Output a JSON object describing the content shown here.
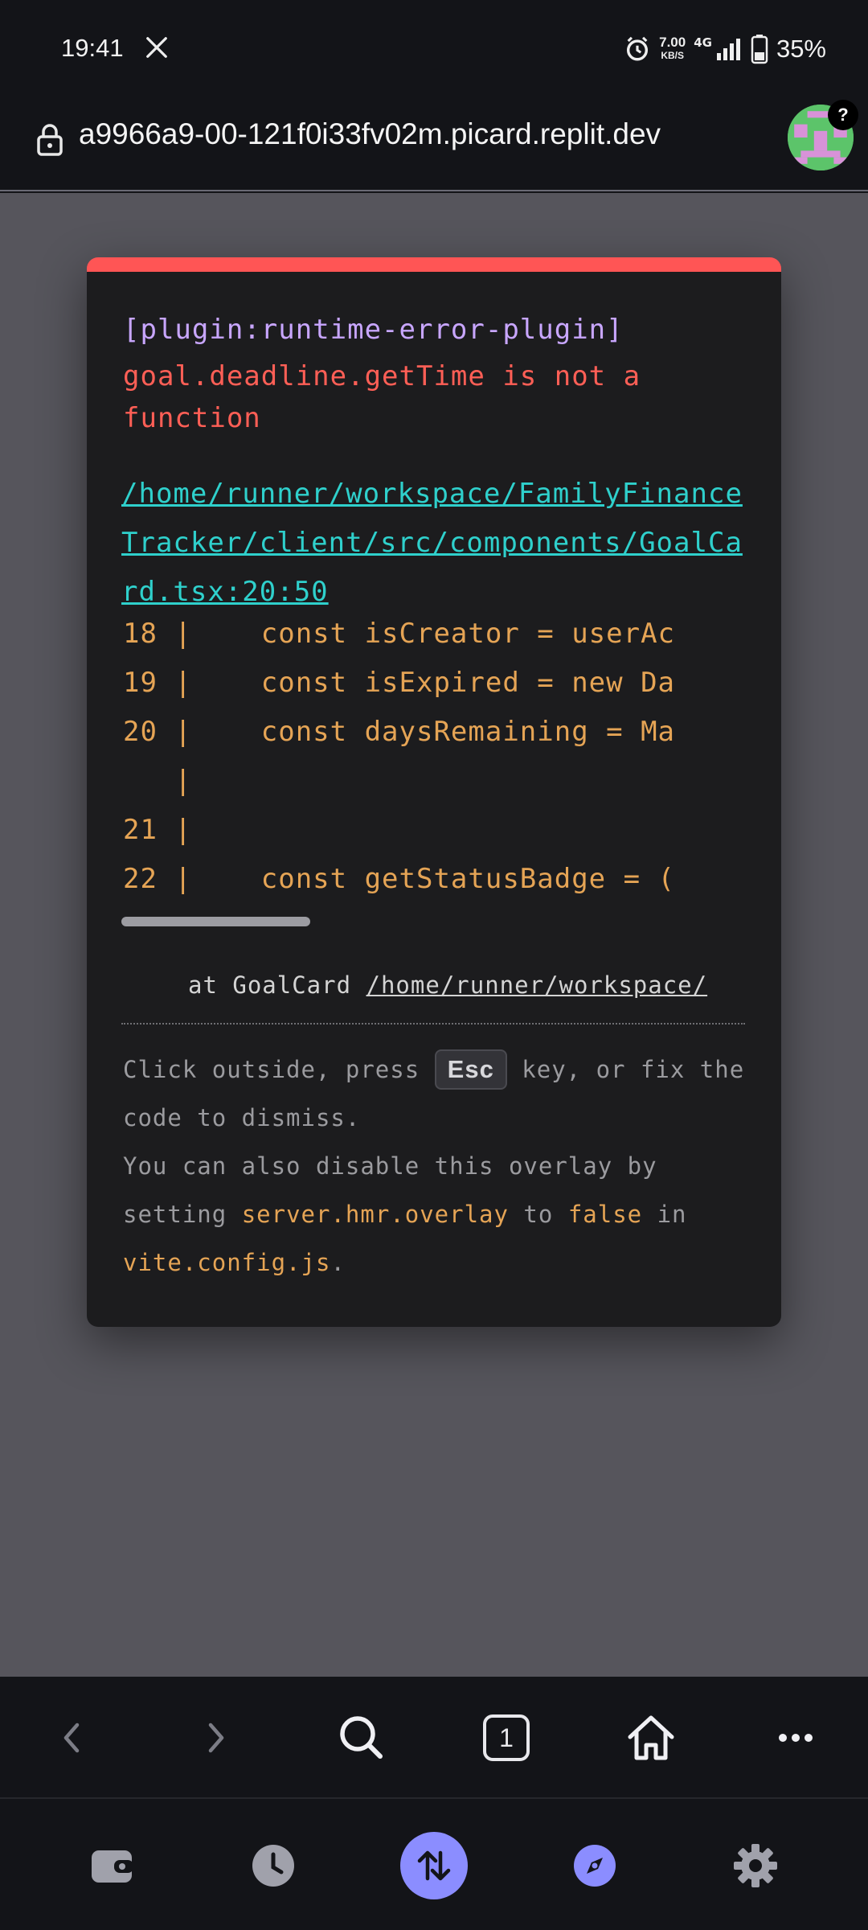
{
  "status_bar": {
    "time": "19:41",
    "net_speed_value": "7.00",
    "net_speed_unit": "KB/S",
    "network_type": "4G",
    "battery": "35%"
  },
  "browser": {
    "url": "a9966a9-00-121f0i33fv02m.picard.replit.dev",
    "help_badge": "?",
    "tab_count": "1"
  },
  "overlay": {
    "plugin": "[plugin:runtime-error-plugin]",
    "message": "goal.deadline.getTime is not a function",
    "file": "/home/runner/workspace/FamilyFinanceTracker/client/src/components/GoalCard.tsx:20:50",
    "code_lines": [
      "18 |    const isCreator = userAc",
      "19 |    const isExpired = new Da",
      "20 |    const daysRemaining = Ma",
      "   |",
      "21 |",
      "22 |    const getStatusBadge = ("
    ],
    "stack_prefix": "at GoalCard ",
    "stack_path": "/home/runner/workspace/",
    "tip_1a": "Click outside, press ",
    "tip_key": "Esc",
    "tip_1b": " key, or fix the code to dismiss.",
    "tip_2a": "You can also disable this overlay by setting ",
    "tip_2_code": "server.hmr.overlay",
    "tip_2b": " to ",
    "tip_2_false": "false",
    "tip_2c": " in ",
    "tip_2_file": "vite.config.js",
    "tip_2d": "."
  },
  "colors": {
    "accent": "#8b8dff",
    "error_bar": "#ff5555",
    "link": "#2fd0cc",
    "code": "#e5a455"
  }
}
